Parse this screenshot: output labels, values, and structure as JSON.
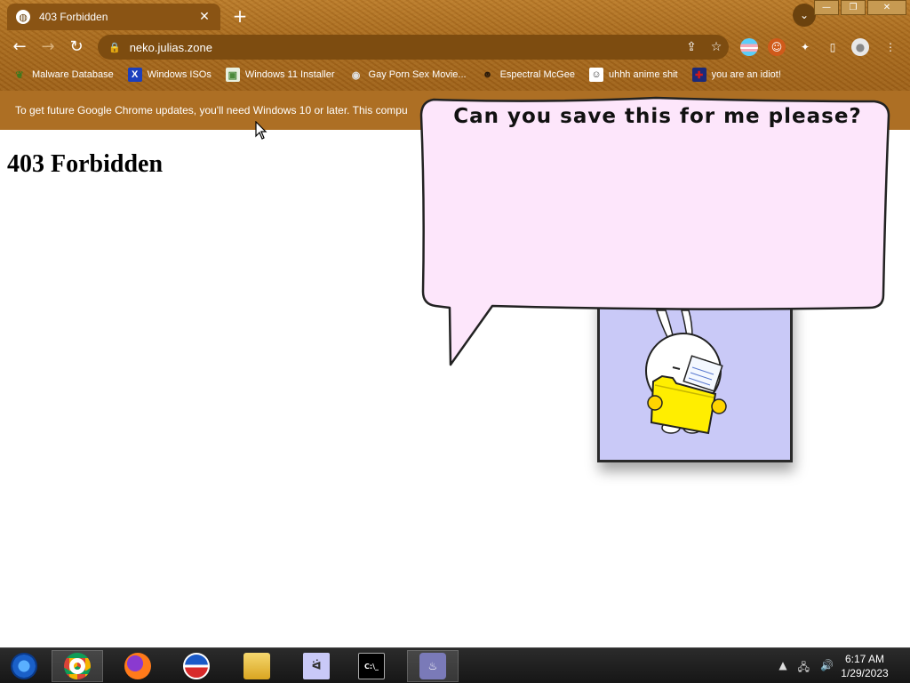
{
  "browser": {
    "tab": {
      "title": "403 Forbidden",
      "favicon": "globe-icon",
      "close": "✕"
    },
    "new_tab": "+",
    "window_controls": {
      "minimize": "—",
      "restore": "❐",
      "close": "✕"
    },
    "url": "neko.julias.zone",
    "bookmarks": [
      {
        "label": "Malware Database",
        "icon": "leaf-icon",
        "icon_glyph": "❦"
      },
      {
        "label": "Windows ISOs",
        "icon": "x-icon",
        "icon_glyph": "X"
      },
      {
        "label": "Windows 11 Installer",
        "icon": "image-icon",
        "icon_glyph": "▣"
      },
      {
        "label": "Gay Porn Sex Movie...",
        "icon": "disc-icon",
        "icon_glyph": "◉"
      },
      {
        "label": "Espectral McGee",
        "icon": "skull-icon",
        "icon_glyph": "☻"
      },
      {
        "label": "uhhh anime shit",
        "icon": "anime-icon",
        "icon_glyph": "☺"
      },
      {
        "label": "you are an idiot!",
        "icon": "flag-icon",
        "icon_glyph": "✚"
      }
    ],
    "infobar_text": "To get future Google Chrome updates, you'll need Windows 10 or later. This compu"
  },
  "page": {
    "heading": "403 Forbidden"
  },
  "neko": {
    "speech": "Can you save this for me please?"
  },
  "taskbar": {
    "time": "6:17 AM",
    "date": "1/29/2023"
  },
  "colors": {
    "chrome_brown": "#a86a1e",
    "infobar": "#ad6f24",
    "bubble_fill": "#fde6fb",
    "neko_bg": "#c9c9f7",
    "folder_yellow": "#ffee00"
  }
}
